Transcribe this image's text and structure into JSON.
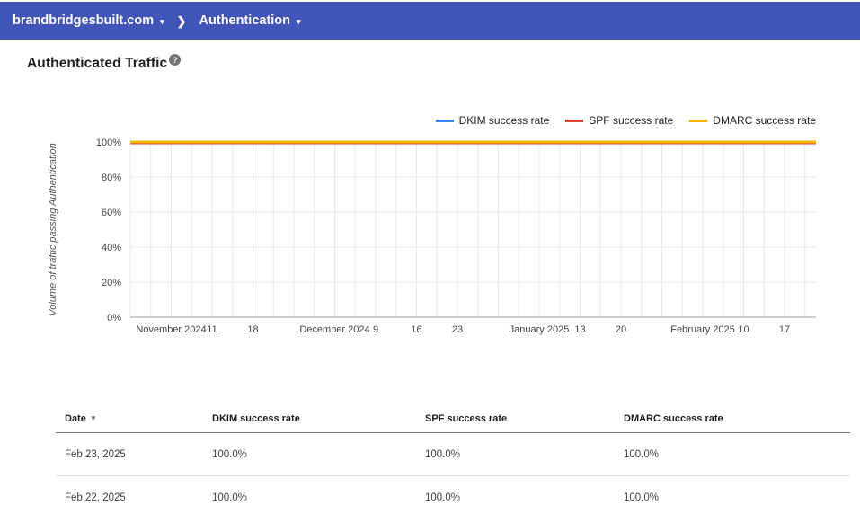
{
  "colors": {
    "navbar-bg": "#4154b8"
  },
  "navbar": {
    "domain": "brandbridgesbuilt.com",
    "section": "Authentication",
    "caret": "▾",
    "separator": "❯"
  },
  "page": {
    "title": "Authenticated Traffic",
    "help_glyph": "?"
  },
  "chart_data": {
    "type": "line",
    "title": "",
    "xlabel": "",
    "ylabel": "Volume of traffic passing Authentication",
    "ylim": [
      0,
      100
    ],
    "grid": true,
    "legend_position": "top-right",
    "y_tick_labels": [
      "100%",
      "80%",
      "60%",
      "40%",
      "20%",
      "0%"
    ],
    "x_tick_labels": [
      "November 2024",
      "11",
      "18",
      "",
      "December 2024",
      "9",
      "16",
      "23",
      "",
      "January 2025",
      "13",
      "20",
      "",
      "February 2025",
      "10",
      "17"
    ],
    "series": [
      {
        "name": "DKIM success rate",
        "color": "#4285f4",
        "values": [
          100,
          100,
          100,
          100,
          100,
          100,
          100,
          100,
          100,
          100,
          100,
          100,
          100,
          100,
          100,
          100,
          100
        ]
      },
      {
        "name": "SPF success rate",
        "color": "#db4437",
        "values": [
          100,
          100,
          100,
          100,
          100,
          100,
          100,
          100,
          100,
          100,
          100,
          100,
          100,
          100,
          100,
          100,
          100
        ]
      },
      {
        "name": "DMARC success rate",
        "color": "#f4b400",
        "values": [
          100,
          100,
          100,
          100,
          100,
          100,
          100,
          100,
          100,
          100,
          100,
          100,
          100,
          100,
          100,
          100,
          100
        ]
      }
    ]
  },
  "table": {
    "headers": [
      "Date",
      "DKIM success rate",
      "SPF success rate",
      "DMARC success rate"
    ],
    "sort_column": "Date",
    "sort_arrow": "▼",
    "rows": [
      [
        "Feb 23, 2025",
        "100.0%",
        "100.0%",
        "100.0%"
      ],
      [
        "Feb 22, 2025",
        "100.0%",
        "100.0%",
        "100.0%"
      ]
    ]
  }
}
